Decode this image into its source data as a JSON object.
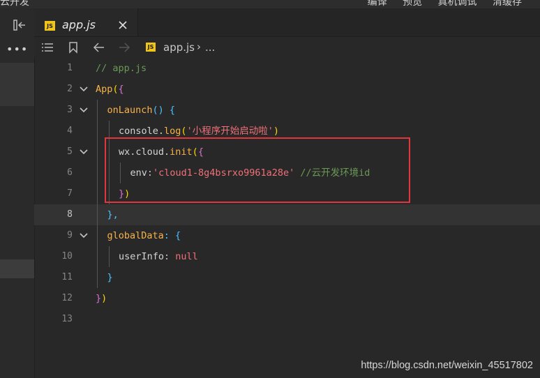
{
  "menubar": {
    "app_title": "云开发",
    "items": [
      "编译",
      "预览",
      "真机调试",
      "清缓存"
    ]
  },
  "tab": {
    "icon": "js-file-icon",
    "badge": "JS",
    "label": "app.js"
  },
  "breadcrumb": {
    "file": "app.js",
    "separator": "›",
    "more": "..."
  },
  "editor": {
    "current_line": 8,
    "lines": [
      {
        "num": "1",
        "indent": 0,
        "fold": false,
        "tokens": [
          {
            "t": "// app.js",
            "c": "comment"
          }
        ]
      },
      {
        "num": "2",
        "indent": 0,
        "fold": true,
        "tokens": [
          {
            "t": "App",
            "c": "fn"
          },
          {
            "t": "(",
            "c": "br1"
          },
          {
            "t": "{",
            "c": "br2"
          }
        ]
      },
      {
        "num": "3",
        "indent": 1,
        "fold": true,
        "tokens": [
          {
            "t": "onLaunch",
            "c": "fn"
          },
          {
            "t": "() {",
            "c": "br3"
          }
        ]
      },
      {
        "num": "4",
        "indent": 2,
        "fold": false,
        "tokens": [
          {
            "t": "console.",
            "c": "plain"
          },
          {
            "t": "log",
            "c": "fn"
          },
          {
            "t": "(",
            "c": "br1"
          },
          {
            "t": "'小程序开始启动啦'",
            "c": "str"
          },
          {
            "t": ")",
            "c": "br1"
          }
        ]
      },
      {
        "num": "5",
        "indent": 2,
        "fold": true,
        "tokens": [
          {
            "t": "wx.cloud.",
            "c": "plain"
          },
          {
            "t": "init",
            "c": "fn"
          },
          {
            "t": "(",
            "c": "br1"
          },
          {
            "t": "{",
            "c": "br2"
          }
        ]
      },
      {
        "num": "6",
        "indent": 3,
        "fold": false,
        "tokens": [
          {
            "t": "env",
            "c": "plain"
          },
          {
            "t": ":",
            "c": "punc"
          },
          {
            "t": "'cloud1-8g4bsrxo9961a28e'",
            "c": "str"
          },
          {
            "t": " //云开发环境id",
            "c": "comment"
          }
        ]
      },
      {
        "num": "7",
        "indent": 2,
        "fold": false,
        "tokens": [
          {
            "t": "}",
            "c": "br2"
          },
          {
            "t": ")",
            "c": "br1"
          }
        ]
      },
      {
        "num": "8",
        "indent": 1,
        "fold": false,
        "tokens": [
          {
            "t": "},",
            "c": "br3"
          }
        ]
      },
      {
        "num": "9",
        "indent": 1,
        "fold": true,
        "tokens": [
          {
            "t": "globalData",
            "c": "fn"
          },
          {
            "t": ": {",
            "c": "br3"
          }
        ]
      },
      {
        "num": "10",
        "indent": 2,
        "fold": false,
        "tokens": [
          {
            "t": "userInfo",
            "c": "plain"
          },
          {
            "t": ": ",
            "c": "punc"
          },
          {
            "t": "null",
            "c": "null"
          }
        ]
      },
      {
        "num": "11",
        "indent": 1,
        "fold": false,
        "tokens": [
          {
            "t": "}",
            "c": "br3"
          }
        ]
      },
      {
        "num": "12",
        "indent": 0,
        "fold": false,
        "tokens": [
          {
            "t": "}",
            "c": "br2"
          },
          {
            "t": ")",
            "c": "br1"
          }
        ]
      },
      {
        "num": "13",
        "indent": 0,
        "fold": false,
        "tokens": []
      }
    ]
  },
  "watermark": "https://blog.csdn.net/weixin_45517802",
  "colors": {
    "highlight_box": "#e0363d",
    "js_badge": "#f0c419"
  }
}
